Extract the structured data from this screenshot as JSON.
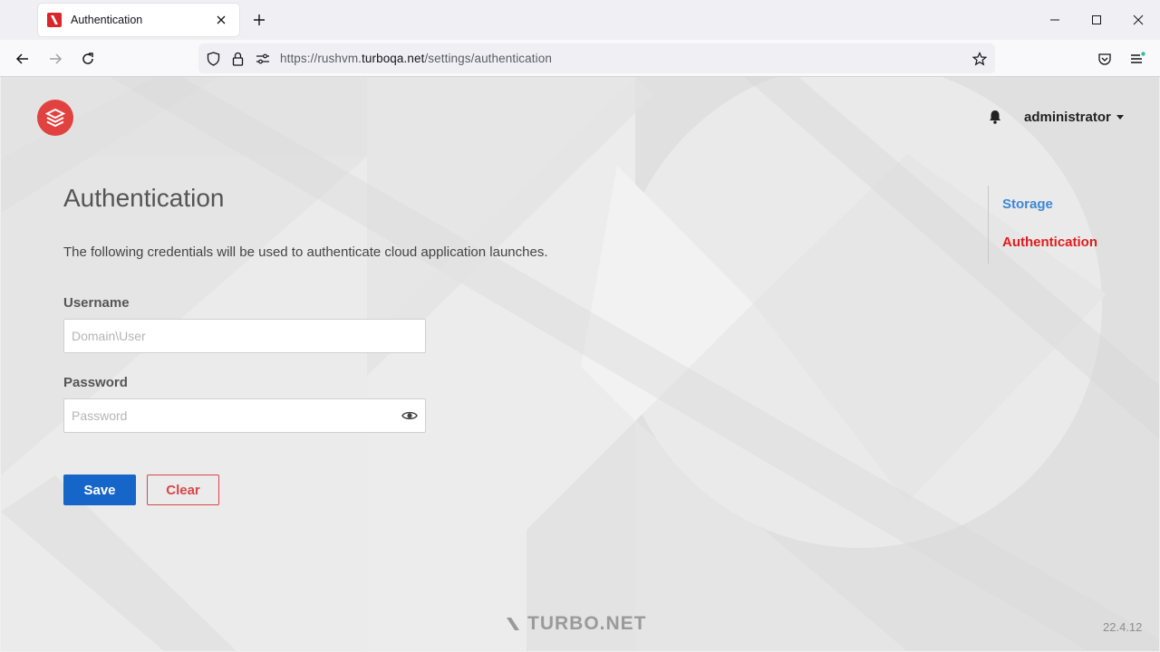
{
  "browser": {
    "tab_title": "Authentication",
    "url_prefix": "https://rushvm.",
    "url_host": "turboqa.net",
    "url_path": "/settings/authentication"
  },
  "header": {
    "user_name": "administrator"
  },
  "side_nav": {
    "items": [
      {
        "label": "Storage"
      },
      {
        "label": "Authentication"
      }
    ]
  },
  "main": {
    "title": "Authentication",
    "description": "The following credentials will be used to authenticate cloud application launches.",
    "username_label": "Username",
    "username_placeholder": "Domain\\User",
    "password_label": "Password",
    "password_placeholder": "Password",
    "save_label": "Save",
    "clear_label": "Clear"
  },
  "footer": {
    "brand": "TURBO.NET",
    "version": "22.4.12"
  },
  "colors": {
    "primary": "#1566c8",
    "danger": "#d94646",
    "active_nav": "#e21b1b",
    "link_nav": "#3d87d6",
    "logo": "#e2423f"
  }
}
